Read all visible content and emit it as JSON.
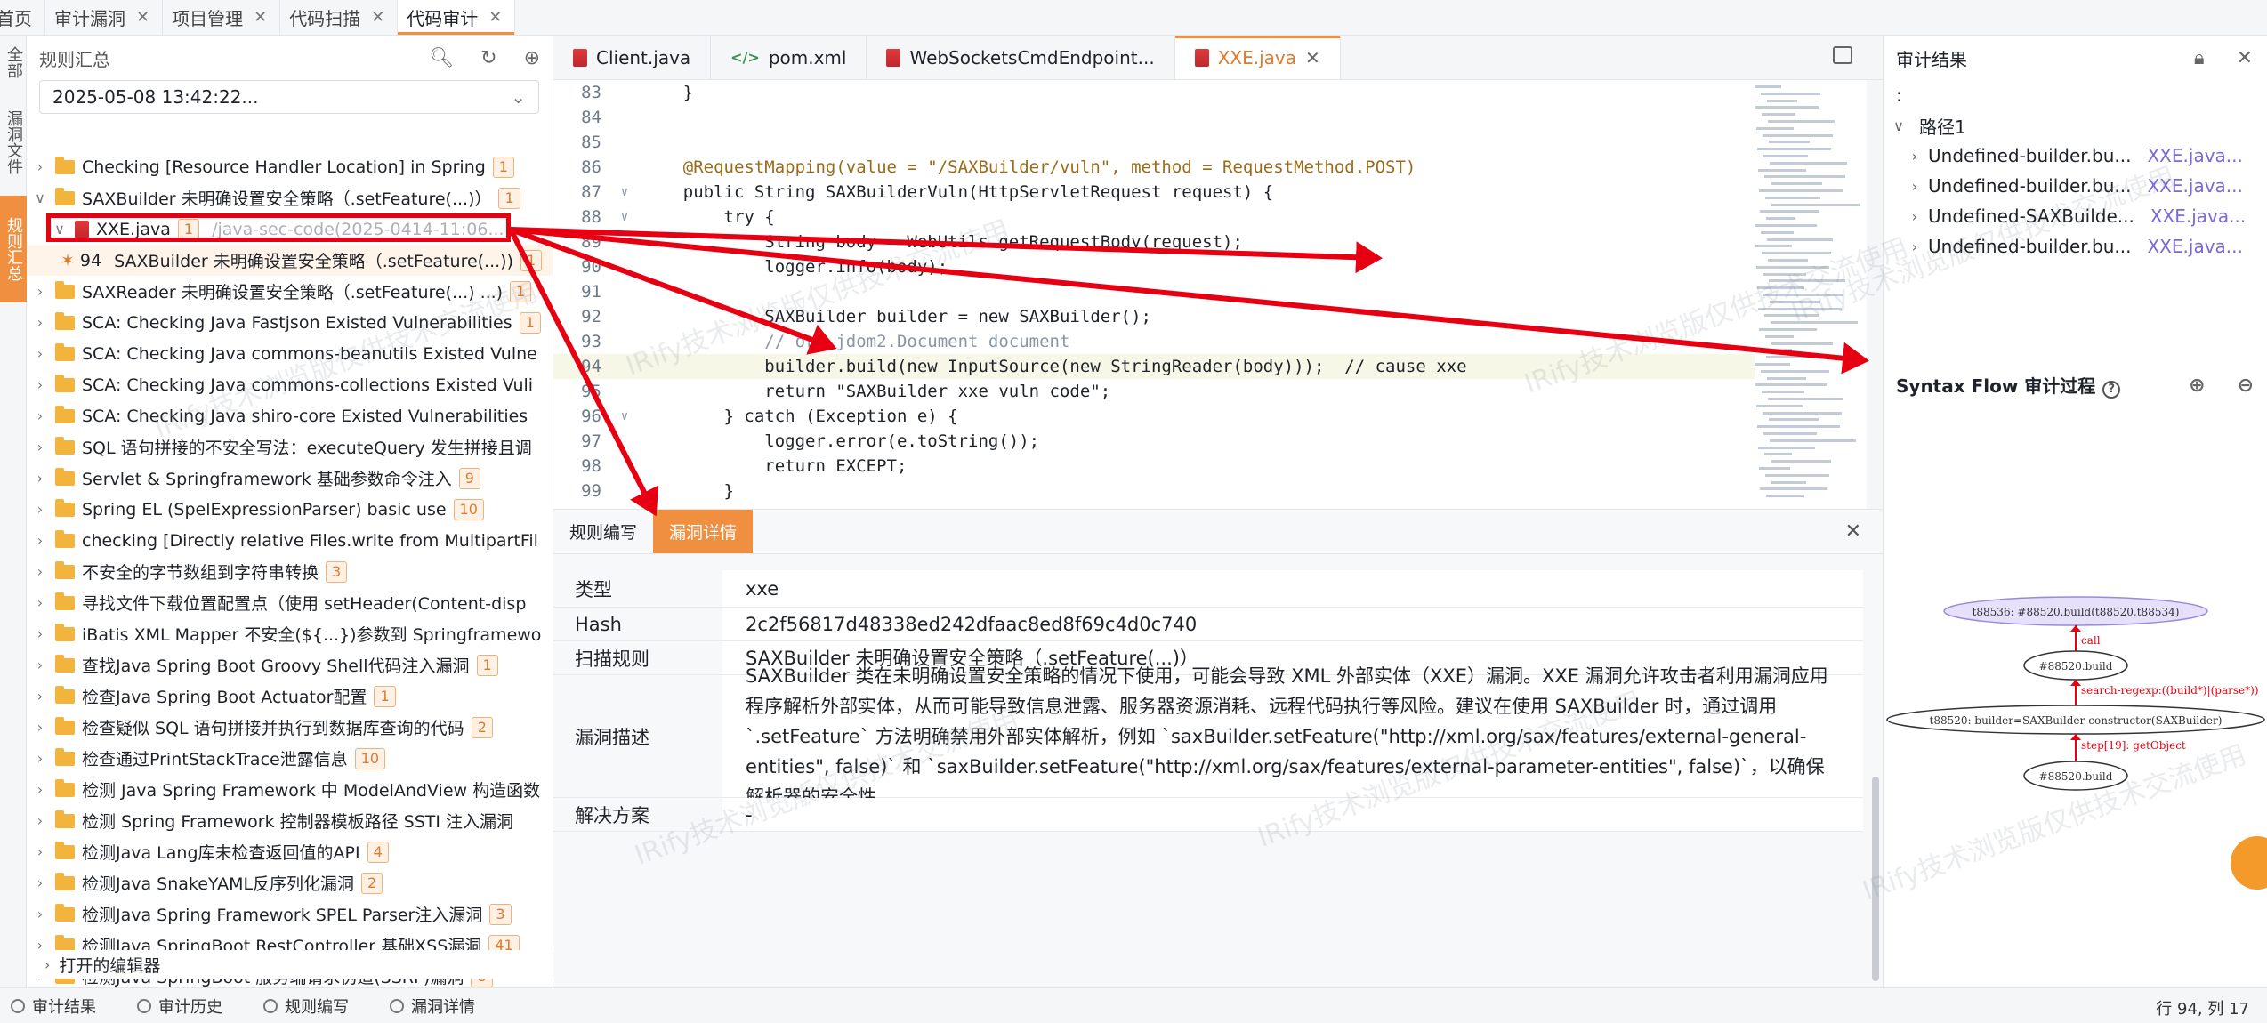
{
  "top_tabs": [
    {
      "label": "首页",
      "closable": false
    },
    {
      "label": "审计漏洞",
      "closable": true
    },
    {
      "label": "项目管理",
      "closable": true
    },
    {
      "label": "代码扫描",
      "closable": true
    },
    {
      "label": "代码审计",
      "closable": true,
      "active": true
    }
  ],
  "side_tabs": [
    "全部",
    "漏洞文件",
    "规则汇总"
  ],
  "left_panel": {
    "title": "规则汇总",
    "date_value": "2025-05-08 13:42:22...",
    "tree": [
      {
        "label": "Checking [Resource Handler Location] in Spring",
        "badge": "1",
        "level": 0
      },
      {
        "label": "SAXBuilder 未明确设置安全策略（.setFeature(...)）",
        "badge": "1",
        "level": 0,
        "expanded": true
      },
      {
        "label": "XXE.java",
        "badge": "1",
        "level": 1,
        "expanded": true,
        "path": "/java-sec-code(2025-0414-11:06..."
      },
      {
        "label": "SAXBuilder 未明确设置安全策略（.setFeature(...))",
        "line": "94",
        "level": 2,
        "selected": true,
        "badge": "1"
      },
      {
        "label": "SAXReader 未明确设置安全策略（.setFeature(...) ...)",
        "badge": "1",
        "level": 0
      },
      {
        "label": "SCA: Checking Java Fastjson Existed Vulnerabilities",
        "badge": "1",
        "level": 0
      },
      {
        "label": "SCA: Checking Java commons-beanutils Existed Vulne",
        "badge": "",
        "level": 0
      },
      {
        "label": "SCA: Checking Java commons-collections Existed Vuli",
        "badge": "",
        "level": 0
      },
      {
        "label": "SCA: Checking Java shiro-core Existed Vulnerabilities",
        "badge": "",
        "level": 0
      },
      {
        "label": "SQL 语句拼接的不安全写法：executeQuery 发生拼接且调",
        "badge": "",
        "level": 0
      },
      {
        "label": "Servlet & Springframework 基础参数命令注入",
        "badge": "9",
        "level": 0
      },
      {
        "label": "Spring EL (SpelExpressionParser) basic use",
        "badge": "10",
        "level": 0
      },
      {
        "label": "checking [Directly relative Files.write from MultipartFil",
        "badge": "",
        "level": 0
      },
      {
        "label": "不安全的字节数组到字符串转换",
        "badge": "3",
        "level": 0
      },
      {
        "label": "寻找文件下载位置配置点（使用 setHeader(Content-disp",
        "badge": "",
        "level": 0
      },
      {
        "label": "iBatis XML Mapper 不安全(${...})参数到 Springframewo",
        "badge": "",
        "level": 0
      },
      {
        "label": "查找Java Spring Boot Groovy Shell代码注入漏洞",
        "badge": "1",
        "level": 0
      },
      {
        "label": "检查Java Spring Boot Actuator配置",
        "badge": "1",
        "level": 0
      },
      {
        "label": "检查疑似 SQL 语句拼接并执行到数据库查询的代码",
        "badge": "2",
        "level": 0
      },
      {
        "label": "检查通过PrintStackTrace泄露信息",
        "badge": "10",
        "level": 0
      },
      {
        "label": "检测 Java Spring Framework 中 ModelAndView 构造函数",
        "badge": "",
        "level": 0
      },
      {
        "label": "检测 Spring Framework 控制器模板路径 SSTI 注入漏洞",
        "badge": "",
        "level": 0
      },
      {
        "label": "检测Java Lang库未检查返回值的API",
        "badge": "4",
        "level": 0
      },
      {
        "label": "检测Java SnakeYAML反序列化漏洞",
        "badge": "2",
        "level": 0
      },
      {
        "label": "检测Java Spring Framework SPEL Parser注入漏洞",
        "badge": "3",
        "level": 0
      },
      {
        "label": "检测Java SpringBoot RestController 基础XSS漏洞",
        "badge": "41",
        "level": 0
      },
      {
        "label": "检测Java SpringBoot 服务端请求伪造(SSRF)漏洞",
        "badge": "8",
        "level": 0
      }
    ],
    "open_editors": "打开的编辑器"
  },
  "editor_tabs": [
    {
      "label": "Client.java",
      "icon": "java-file-icon"
    },
    {
      "label": "pom.xml",
      "icon": "xml-file-icon"
    },
    {
      "label": "WebSocketsCmdEndpoint...",
      "icon": "java-file-icon"
    },
    {
      "label": "XXE.java",
      "icon": "java-file-icon",
      "active": true,
      "closable": true
    }
  ],
  "code_lines": [
    {
      "n": "83",
      "text": "    }"
    },
    {
      "n": "84",
      "text": ""
    },
    {
      "n": "85",
      "text": ""
    },
    {
      "n": "86",
      "text": "    @RequestMapping(value = \"/SAXBuilder/vuln\", method = RequestMethod.POST)"
    },
    {
      "n": "87",
      "text": "    public String SAXBuilderVuln(HttpServletRequest request) {"
    },
    {
      "n": "88",
      "text": "        try {"
    },
    {
      "n": "89",
      "text": "            String body = WebUtils.getRequestBody(request);"
    },
    {
      "n": "90",
      "text": "            logger.info(body);"
    },
    {
      "n": "91",
      "text": ""
    },
    {
      "n": "92",
      "text": "            SAXBuilder builder = new SAXBuilder();"
    },
    {
      "n": "93",
      "text": "            // org.jdom2.Document document"
    },
    {
      "n": "94",
      "text": "            builder.build(new InputSource(new StringReader(body)));  // cause xxe",
      "highlight": true
    },
    {
      "n": "95",
      "text": "            return \"SAXBuilder xxe vuln code\";"
    },
    {
      "n": "96",
      "text": "        } catch (Exception e) {"
    },
    {
      "n": "97",
      "text": "            logger.error(e.toString());"
    },
    {
      "n": "98",
      "text": "            return EXCEPT;"
    },
    {
      "n": "99",
      "text": "        }"
    }
  ],
  "bottom_panel": {
    "tabs": [
      {
        "label": "规则编写",
        "active": false
      },
      {
        "label": "漏洞详情",
        "active": true
      }
    ],
    "details": [
      {
        "label": "类型",
        "value": "xxe"
      },
      {
        "label": "Hash",
        "value": "2c2f56817d48338ed242dfaac8ed8f69c4d0c740"
      },
      {
        "label": "扫描规则",
        "value": "SAXBuilder 未明确设置安全策略（.setFeature(...)）"
      },
      {
        "label": "漏洞描述",
        "value": "SAXBuilder 类在未明确设置安全策略的情况下使用，可能会导致 XML 外部实体（XXE）漏洞。XXE 漏洞允许攻击者利用漏洞应用程序解析外部实体，从而可能导致信息泄露、服务器资源消耗、远程代码执行等风险。建议在使用 SAXBuilder 时，通过调用 `.setFeature` 方法明确禁用外部实体解析，例如 `saxBuilder.setFeature(\"http://xml.org/sax/features/external-general-entities\", false)` 和 `saxBuilder.setFeature(\"http://xml.org/sax/features/external-parameter-entities\", false)`，以确保解析器的安全性。"
      },
      {
        "label": "解决方案",
        "value": "-"
      }
    ]
  },
  "right_panel": {
    "title": "审计结果",
    "colon": ":",
    "path_label": "路径1",
    "results": [
      {
        "name": "Undefined-builder.bu...",
        "file": "XXE.java..."
      },
      {
        "name": "Undefined-builder.bu...",
        "file": "XXE.java..."
      },
      {
        "name": "Undefined-SAXBuilde...",
        "file": "XXE.java..."
      },
      {
        "name": "Undefined-builder.bu...",
        "file": "XXE.java..."
      }
    ],
    "syntax_flow_title": "Syntax Flow 审计过程",
    "graph": {
      "nodes": [
        "t88536: #88520.build(t88520,t88534)",
        "#88520.build",
        "t88520: builder=SAXBuilder-constructor(SAXBuilder)",
        "#88520.build"
      ],
      "edges": [
        "call",
        "search-regexp:((build*)|(parse*))",
        "step[19]: getObject"
      ]
    }
  },
  "status_bar": {
    "items": [
      "审计结果",
      "审计历史",
      "规则编写",
      "漏洞详情"
    ],
    "cursor": "行 94,  列 17"
  },
  "watermark": "IRify技术浏览版仅供技术交流使用",
  "colors": {
    "accent": "#f08f40",
    "annotation_red": "#e60012",
    "link_purple": "#7a6ad8"
  }
}
